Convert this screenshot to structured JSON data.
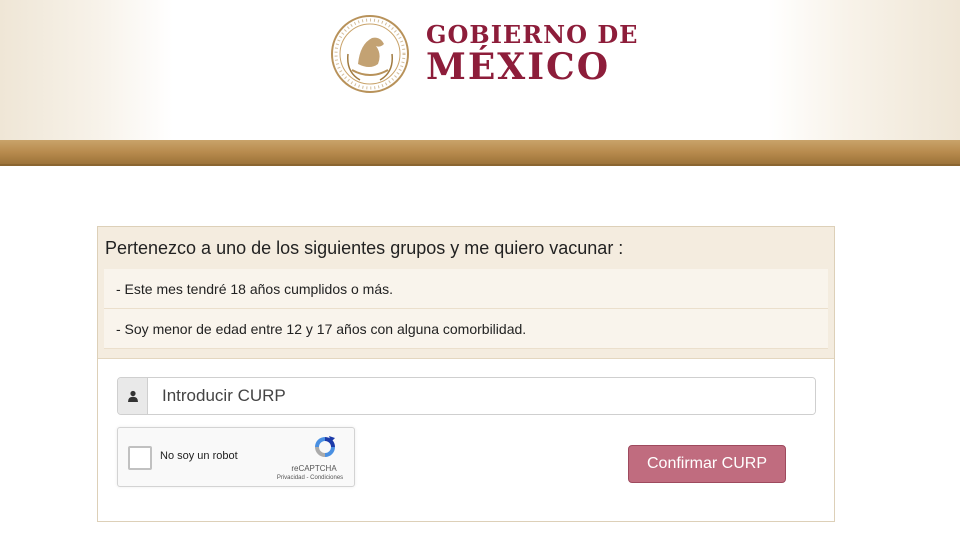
{
  "header": {
    "logo_line1": "GOBIERNO DE",
    "logo_line2": "MÉXICO",
    "brand_color": "#8d1d3a",
    "band_color": "#b88b4e"
  },
  "card": {
    "title": "Pertenezco a uno de los siguientes grupos y me quiero vacunar :",
    "groups": [
      "- Este mes tendré 18 años cumplidos o más.",
      "- Soy menor de edad entre 12 y 17 años con alguna comorbilidad."
    ]
  },
  "form": {
    "curp_placeholder": "Introducir CURP",
    "curp_value": "",
    "user_icon": "user-icon",
    "confirm_label": "Confirmar CURP",
    "confirm_color": "#c06c7f"
  },
  "recaptcha": {
    "label": "No soy un robot",
    "brand": "reCAPTCHA",
    "links": "Privacidad - Condiciones"
  }
}
